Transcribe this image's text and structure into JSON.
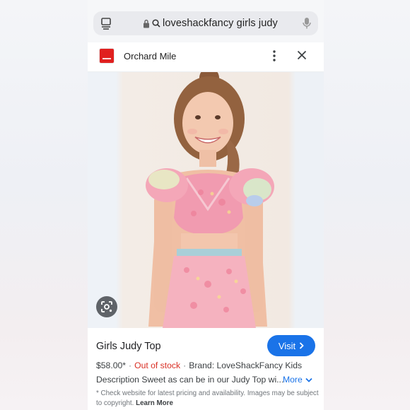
{
  "search": {
    "query": "loveshackfancy girls judy"
  },
  "result": {
    "site_name": "Orchard Mile"
  },
  "icons": {
    "tabs": "tabs-icon",
    "lock": "lock-icon",
    "search": "search-icon",
    "mic": "mic-icon",
    "more": "more-vert-icon",
    "close": "close-icon",
    "lens": "lens-icon",
    "chevron_right": "chevron-right-icon",
    "chevron_down": "chevron-down-icon"
  },
  "product": {
    "title": "Girls Judy Top",
    "visit_label": "Visit",
    "price": "$58.00*",
    "stock": "Out of stock",
    "brand": "Brand: LoveShackFancy Kids",
    "description": "Description Sweet as can be in our Judy Top wi...",
    "more_label": "More",
    "disclaimer_text": "* Check website for latest pricing and availability. Images may be subject to copyright.",
    "learn_more": "Learn More"
  },
  "colors": {
    "accent": "#1a73e8",
    "out_of_stock": "#d93025",
    "logo": "#e0201f"
  }
}
